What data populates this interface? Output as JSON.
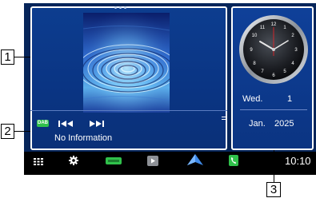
{
  "callouts": {
    "label_1": "1",
    "label_2": "2",
    "label_3": "3"
  },
  "media": {
    "source_badge": "DAB",
    "prev_icon": "skip-previous-icon",
    "next_icon": "skip-next-icon",
    "menu_icon": "list-menu-icon",
    "track_info": "No Information"
  },
  "calendar": {
    "weekday": "Wed.",
    "day": "1",
    "month": "Jan.",
    "year": "2025"
  },
  "dock": {
    "items": [
      "apps-grid-icon",
      "settings-gear-icon",
      "dab-radio-icon",
      "media-player-icon",
      "navigation-arrow-icon",
      "phone-icon"
    ],
    "time": "10:10"
  },
  "colors": {
    "screen": "#06255a",
    "panel": "#0a3584",
    "dock": "#000000",
    "accent_green": "#30c14b"
  }
}
